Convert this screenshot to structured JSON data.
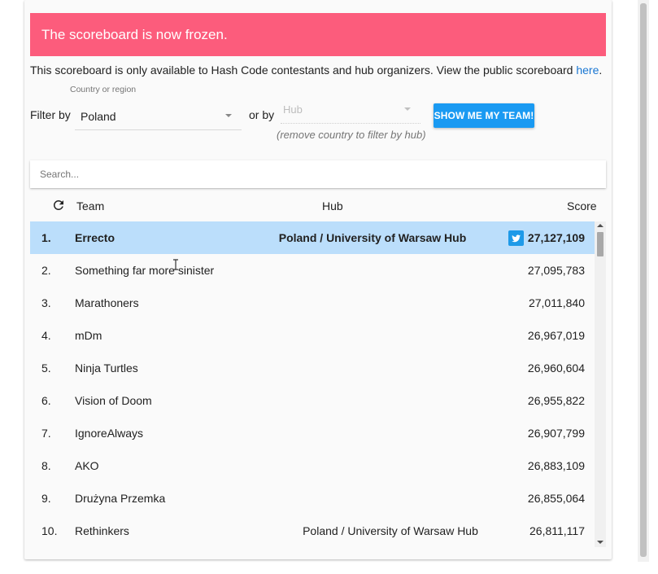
{
  "banner": {
    "text": "The scoreboard is now frozen."
  },
  "notice": {
    "text": "This scoreboard is only available to Hash Code contestants and hub organizers. View the public scoreboard ",
    "link_text": "here",
    "suffix": "."
  },
  "filters": {
    "filter_by_label": "Filter by",
    "country_caption": "Country or region",
    "country_value": "Poland",
    "or_by_label": "or by",
    "hub_placeholder": "Hub",
    "hub_hint": "(remove country to filter by hub)",
    "show_team_button": "SHOW ME MY TEAM!"
  },
  "search": {
    "placeholder": "Search..."
  },
  "table": {
    "headers": {
      "team": "Team",
      "hub": "Hub",
      "score": "Score"
    },
    "rows": [
      {
        "rank": "1.",
        "team": "Errecto",
        "hub": "Poland / University of Warsaw Hub",
        "score": "27,127,109"
      },
      {
        "rank": "2.",
        "team": "Something far more sinister",
        "hub": "",
        "score": "27,095,783"
      },
      {
        "rank": "3.",
        "team": "Marathoners",
        "hub": "",
        "score": "27,011,840"
      },
      {
        "rank": "4.",
        "team": "mDm",
        "hub": "",
        "score": "26,967,019"
      },
      {
        "rank": "5.",
        "team": "Ninja Turtles",
        "hub": "",
        "score": "26,960,604"
      },
      {
        "rank": "6.",
        "team": "Vision of Doom",
        "hub": "",
        "score": "26,955,822"
      },
      {
        "rank": "7.",
        "team": "IgnoreAlways",
        "hub": "",
        "score": "26,907,799"
      },
      {
        "rank": "8.",
        "team": "AKO",
        "hub": "",
        "score": "26,883,109"
      },
      {
        "rank": "9.",
        "team": "Drużyna Przemka",
        "hub": "",
        "score": "26,855,064"
      },
      {
        "rank": "10.",
        "team": "Rethinkers",
        "hub": "Poland / University of Warsaw Hub",
        "score": "26,811,117"
      }
    ]
  },
  "colors": {
    "banner": "#fc5c7c",
    "button": "#1a9af2",
    "highlight_row": "#bbdefb",
    "link": "#1976d2",
    "twitter": "#1e9ae8"
  },
  "icons": {
    "refresh": "refresh-icon",
    "twitter": "twitter-icon"
  }
}
